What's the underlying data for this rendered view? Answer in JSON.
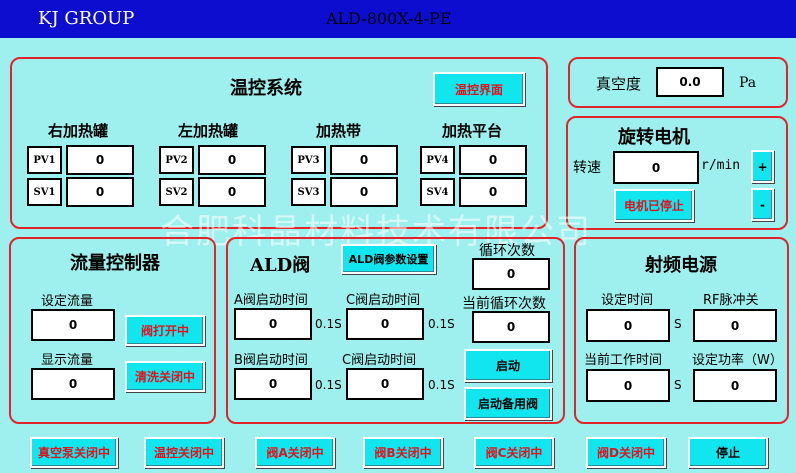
{
  "header": {
    "brand": "KJ GROUP",
    "model": "ALD-800X-4-PE"
  },
  "temp": {
    "title": "温控系统",
    "ui_button": "温控界面",
    "groups": [
      {
        "name": "右加热罐",
        "pv_tag": "PV1",
        "pv": "0",
        "sv_tag": "SV1",
        "sv": "0"
      },
      {
        "name": "左加热罐",
        "pv_tag": "PV2",
        "pv": "0",
        "sv_tag": "SV2",
        "sv": "0"
      },
      {
        "name": "加热带",
        "pv_tag": "PV3",
        "pv": "0",
        "sv_tag": "SV3",
        "sv": "0"
      },
      {
        "name": "加热平台",
        "pv_tag": "PV4",
        "pv": "0",
        "sv_tag": "SV4",
        "sv": "0"
      }
    ]
  },
  "vacuum": {
    "label": "真空度",
    "value": "0.0",
    "unit": "Pa"
  },
  "motor": {
    "title": "旋转电机",
    "speed_label": "转速",
    "speed": "0",
    "unit": "r/min",
    "plus": "+",
    "minus": "-",
    "status": "电机已停止"
  },
  "watermark": "合肥科晶材料技术有限公司",
  "flow": {
    "title": "流量控制器",
    "set_label": "设定流量",
    "set_value": "0",
    "show_label": "显示流量",
    "show_value": "0",
    "valve_btn": "阀打开中",
    "purge_btn": "清洗关闭中"
  },
  "ald": {
    "title": "ALD阀",
    "param_btn": "ALD阀参数设置",
    "cycle_label": "循环次数",
    "cycle": "0",
    "cur_cycle_label": "当前循环次数",
    "cur_cycle": "0",
    "a_label": "A阀启动时间",
    "a": "0",
    "c1_label": "C阀启动时间",
    "c1": "0",
    "b_label": "B阀启动时间",
    "b": "0",
    "c2_label": "C阀启动时间",
    "c2": "0",
    "unit": "0.1S",
    "start_btn": "启动",
    "backup_btn": "启动备用阀"
  },
  "rf": {
    "title": "射频电源",
    "set_time_label": "设定时间",
    "set_time": "0",
    "rf_pulse_label": "RF脉冲关",
    "rf_pulse": "0",
    "cur_time_label": "当前工作时间",
    "cur_time": "0",
    "power_label": "设定功率（W）",
    "power": "0",
    "s": "S"
  },
  "bottom": {
    "vacuum_pump": "真空泵关闭中",
    "temp_ctrl": "温控关闭中",
    "valve_a": "阀A关闭中",
    "valve_b": "阀B关闭中",
    "valve_c": "阀C关闭中",
    "valve_d": "阀D关闭中",
    "stop": "停止"
  }
}
